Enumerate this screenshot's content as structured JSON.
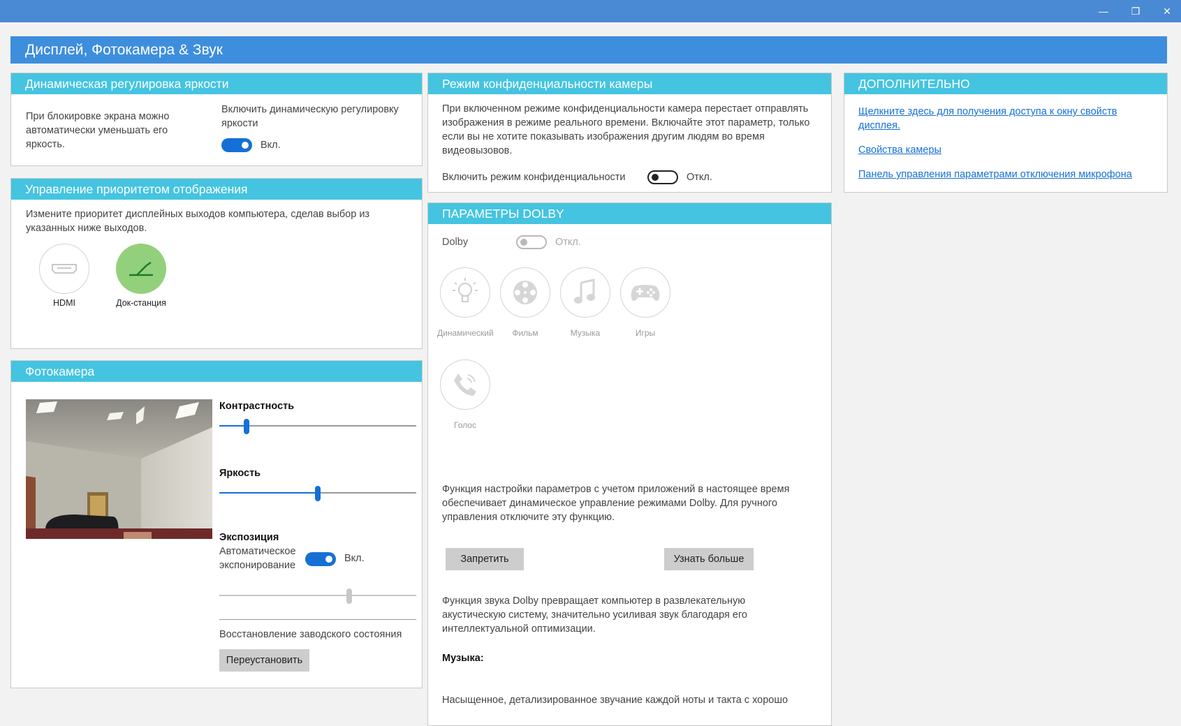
{
  "window": {
    "title": "Дисплей, Фотокамера & Звук",
    "min_icon": "minimize-icon",
    "max_icon": "restore-icon",
    "close_icon": "close-icon"
  },
  "brightness": {
    "title": "Динамическая регулировка яркости",
    "description": "При блокировке экрана можно автоматически уменьшать его яркость.",
    "toggle_label": "Включить динамическую регулировку яркости",
    "state": "Вкл."
  },
  "display_priority": {
    "title": "Управление приоритетом отображения",
    "description": "Измените приоритет дисплейных выходов компьютера, сделав выбор из указанных ниже выходов.",
    "outputs": [
      {
        "label": "HDMI",
        "icon": "hdmi-icon",
        "selected": false
      },
      {
        "label": "Док-станция",
        "icon": "dock-icon",
        "selected": true
      }
    ]
  },
  "camera": {
    "title": "Фотокамера",
    "contrast_label": "Контрастность",
    "contrast_value": 0.14,
    "brightness_label": "Яркость",
    "brightness_value": 0.5,
    "exposure_label": "Экспозиция",
    "auto_exposure_label": "Автоматическое экспонирование",
    "auto_exposure_state": "Вкл.",
    "exposure_value": 0.66,
    "reset_label": "Восстановление заводского состояния",
    "reset_button": "Переустановить"
  },
  "privacy": {
    "title": "Режим конфиденциальности камеры",
    "description": "При включенном режиме конфиденциальности камера перестает отправлять изображения в режиме реального времени. Включайте этот параметр, только если вы не хотите показывать изображения другим людям во время видеовызовов.",
    "toggle_label": "Включить режим конфиденциальности",
    "state": "Откл."
  },
  "dolby": {
    "title": "ПАРАМЕТРЫ DOLBY",
    "label": "Dolby",
    "state": "Откл.",
    "modes": [
      {
        "label": "Динамический",
        "icon": "lightbulb-icon"
      },
      {
        "label": "Фильм",
        "icon": "film-reel-icon"
      },
      {
        "label": "Музыка",
        "icon": "music-note-icon"
      },
      {
        "label": "Игры",
        "icon": "gamepad-icon"
      },
      {
        "label": "Голос",
        "icon": "phone-icon"
      }
    ],
    "app_aware_text": "Функция настройки параметров с учетом приложений в настоящее время обеспечивает динамическое управление режимами Dolby. Для ручного управления отключите эту функцию.",
    "deny_button": "Запретить",
    "learn_more_button": "Узнать больше",
    "dolby_text": "Функция звука Dolby превращает компьютер в развлекательную акустическую систему, значительно усиливая звук благодаря его интеллектуальной оптимизации.",
    "music_heading": "Музыка:",
    "music_text": "Насыщенное, детализированное звучание каждой ноты и такта с хорошо"
  },
  "additional": {
    "title": "ДОПОЛНИТЕЛЬНО",
    "links": [
      "Щелкните здесь для получения доступа к окну свойств дисплея.",
      "Свойства камеры",
      "Панель управления параметрами отключения микрофона"
    ]
  },
  "colors": {
    "titlebar": "#4a8ad4",
    "header": "#3e8ede",
    "panel_head": "#44c4e0",
    "accent": "#1570d6",
    "dock_selected": "#93d07c"
  }
}
